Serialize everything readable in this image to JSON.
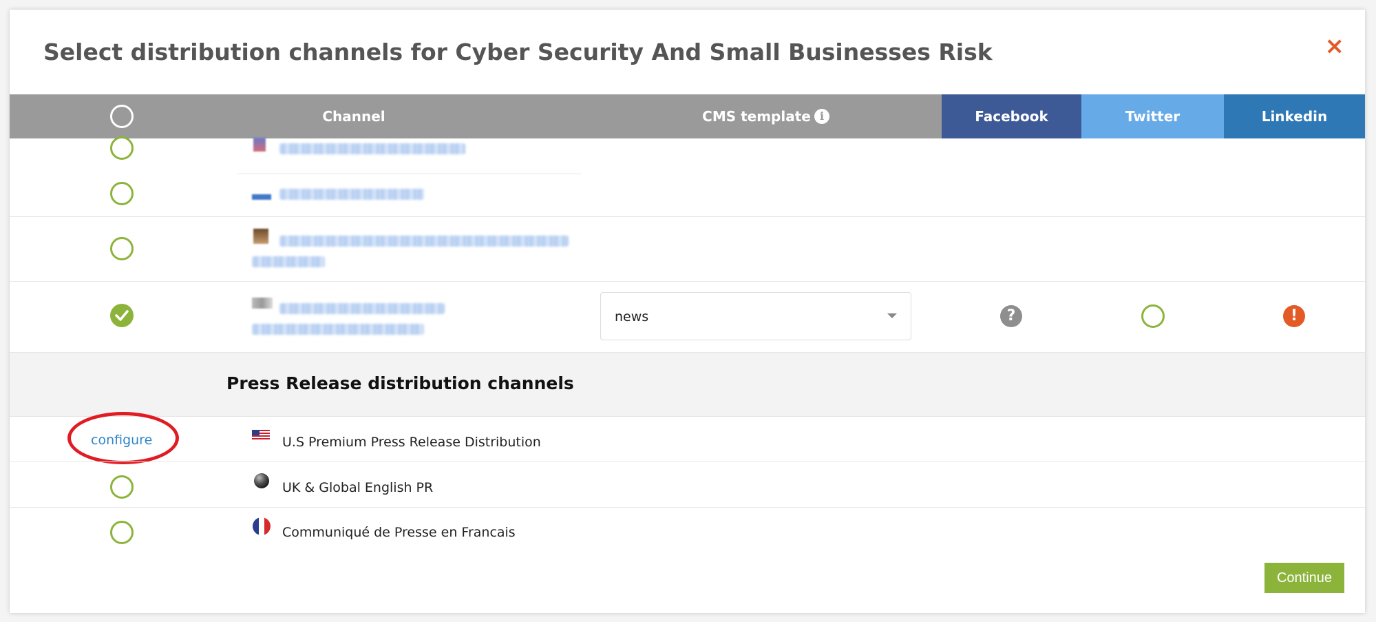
{
  "modal": {
    "title": "Select distribution channels for Cyber Security And Small Businesses Risk",
    "close_label": "×"
  },
  "table_header": {
    "channel": "Channel",
    "cms_template": "CMS template",
    "facebook": "Facebook",
    "twitter": "Twitter",
    "linkedin": "Linkedin"
  },
  "channels": [
    {
      "status": "unselected",
      "name_blurred": true
    },
    {
      "status": "unselected",
      "name_blurred": true
    },
    {
      "status": "unselected",
      "name_blurred": true
    },
    {
      "status": "selected",
      "name_blurred": true,
      "cms_template": "news",
      "facebook_status": "question-icon",
      "twitter_status": "unselected",
      "linkedin_status": "alert-icon"
    }
  ],
  "press_release": {
    "section_title": "Press Release distribution channels",
    "items": [
      {
        "action": "configure",
        "name": "U.S Premium Press Release Distribution",
        "icon": "us-flag-icon"
      },
      {
        "action": "select",
        "name": "UK & Global English PR",
        "icon": "globe-icon"
      },
      {
        "action": "select",
        "name": "Communiqué de Presse en Francais",
        "icon": "french-flag-icon"
      }
    ]
  },
  "footer": {
    "continue_label": "Continue"
  },
  "colors": {
    "accent_green": "#8cb43b",
    "header_gray": "#9a9a9a",
    "facebook_blue": "#3d5a97",
    "twitter_blue": "#67aae8",
    "linkedin_blue": "#2e78b5",
    "close_orange": "#e35a27",
    "link_blue": "#2f86c8"
  }
}
